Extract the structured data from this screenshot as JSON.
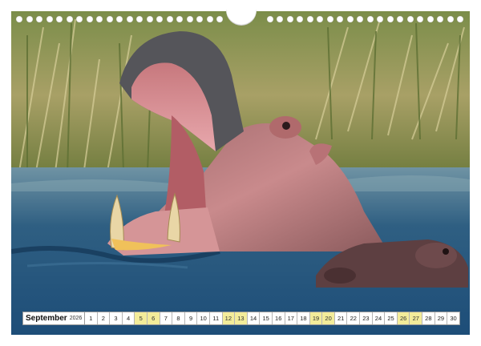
{
  "calendar": {
    "month": "September",
    "year": "2026",
    "days": [
      "1",
      "2",
      "3",
      "4",
      "5",
      "6",
      "7",
      "8",
      "9",
      "10",
      "11",
      "12",
      "13",
      "14",
      "15",
      "16",
      "17",
      "18",
      "19",
      "20",
      "21",
      "22",
      "23",
      "24",
      "25",
      "26",
      "27",
      "28",
      "29",
      "30"
    ],
    "weekend_days": [
      "5",
      "6",
      "12",
      "13",
      "19",
      "20",
      "26",
      "27"
    ],
    "weekend_color": "#f3ec9a"
  },
  "photo": {
    "subject": "hippo-icon"
  }
}
